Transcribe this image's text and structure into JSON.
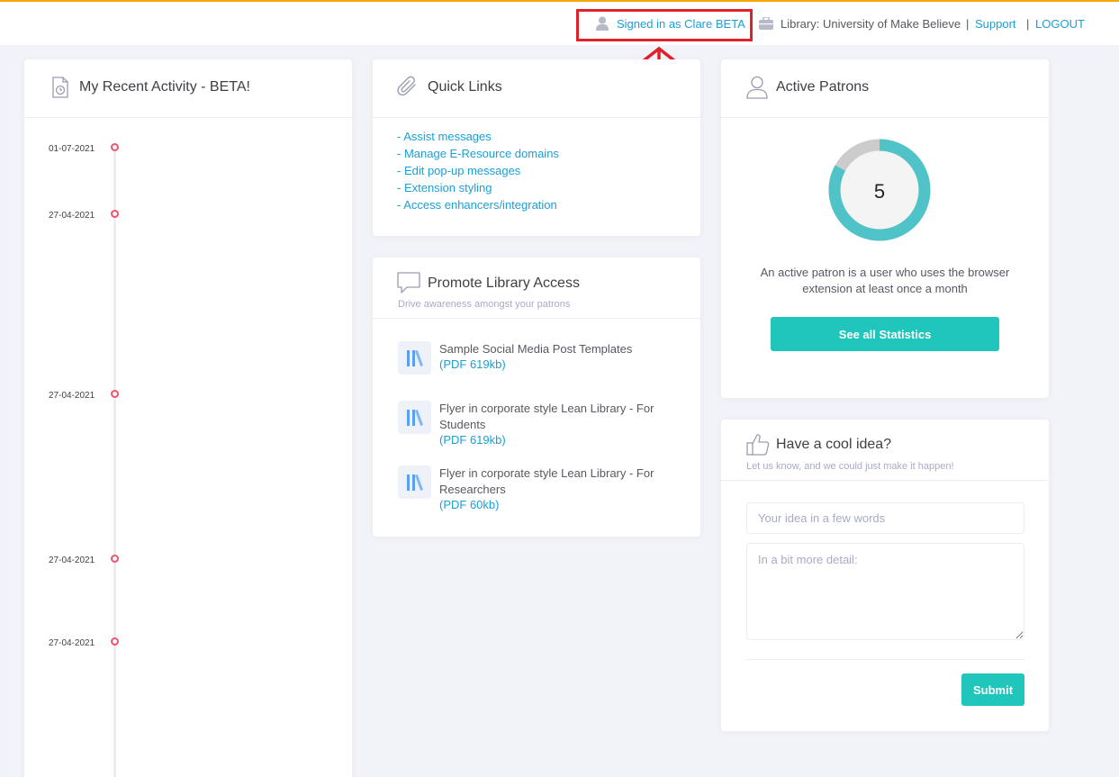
{
  "topbar": {
    "user_label": "Signed in as Clare BETA",
    "library_label": "Library: University of Make Believe",
    "divider": "|",
    "support_label": "Support",
    "logout_label": "LOGOUT",
    "accent_color": "#f7a800",
    "highlight_color": "#e0202b"
  },
  "activity": {
    "title": "My Recent Activity - BETA!",
    "entries": [
      {
        "date": "01-07-2021"
      },
      {
        "date": "27-04-2021"
      },
      {
        "date": "27-04-2021"
      },
      {
        "date": "27-04-2021"
      },
      {
        "date": "27-04-2021"
      }
    ]
  },
  "quick_links": {
    "title": "Quick Links",
    "links": [
      "- Assist messages",
      "- Manage E-Resource domains",
      "- Edit pop-up messages",
      "- Extension styling",
      "- Access enhancers/integration"
    ]
  },
  "promote": {
    "title": "Promote Library Access",
    "subtitle": "Drive awareness amongst your patrons",
    "docs": [
      {
        "title": "Sample Social Media Post Templates",
        "link": "(PDF 619kb)"
      },
      {
        "title": "Flyer in corporate style Lean Library - For Students",
        "link": "(PDF 619kb)"
      },
      {
        "title": "Flyer in corporate style Lean Library - For Researchers",
        "link": "(PDF 60kb)"
      }
    ]
  },
  "patrons": {
    "title": "Active Patrons",
    "count": "5",
    "description": "An active patron is a user who uses the browser extension at least once a month",
    "button_label": "See all Statistics",
    "ring_fill_fraction": 0.83,
    "ring_color": "#4fc3c7",
    "ring_track_color": "#cccccc"
  },
  "idea": {
    "title": "Have a cool idea?",
    "subtitle": "Let us know, and we could just make it happen!",
    "short_placeholder": "Your idea in a few words",
    "detail_placeholder": "In a bit more detail:",
    "submit_label": "Submit"
  }
}
